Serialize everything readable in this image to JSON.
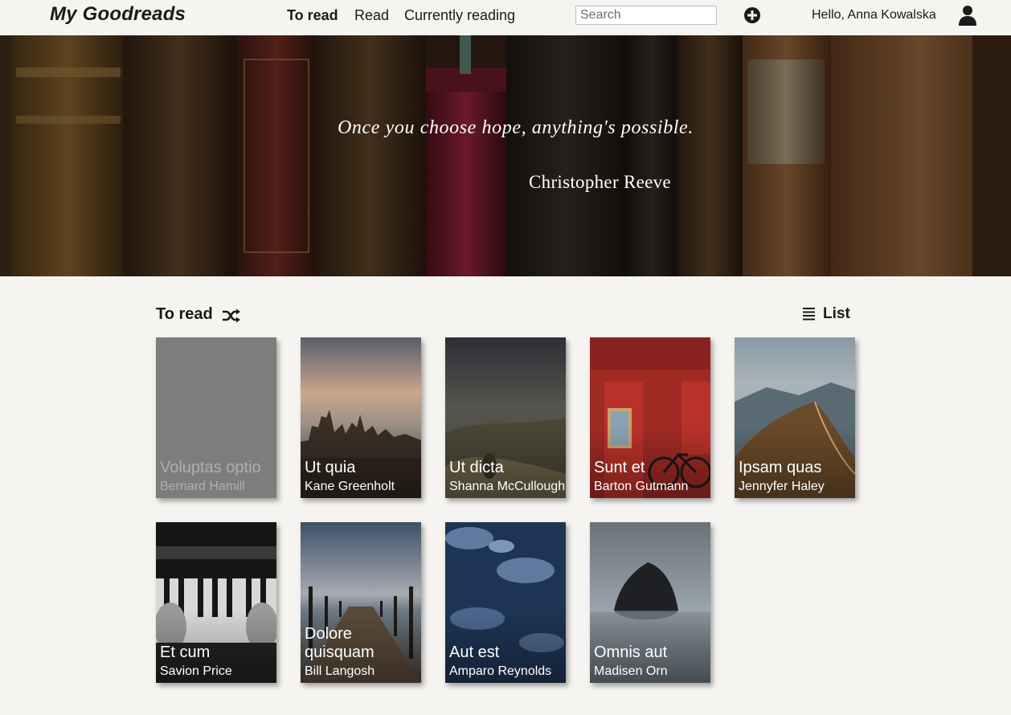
{
  "nav": {
    "brand": "My Goodreads",
    "links": [
      "To read",
      "Read",
      "Currently reading"
    ],
    "search_placeholder": "Search",
    "greeting": "Hello, Anna Kowalska"
  },
  "hero": {
    "quote": "Once you choose hope, anything's possible.",
    "author": "Christopher Reeve"
  },
  "section": {
    "title": "To read",
    "view_toggle": "List"
  },
  "books": [
    {
      "title": "Voluptas optio",
      "author": "Bernard Hamill"
    },
    {
      "title": "Ut quia",
      "author": "Kane Greenholt"
    },
    {
      "title": "Ut dicta",
      "author": "Shanna McCullough"
    },
    {
      "title": "Sunt et",
      "author": "Barton Gutmann"
    },
    {
      "title": "Ipsam quas",
      "author": "Jennyfer Haley"
    },
    {
      "title": "Et cum",
      "author": "Savion Price"
    },
    {
      "title": "Dolore quisquam",
      "author": "Bill Langosh"
    },
    {
      "title": "Aut est",
      "author": "Amparo Reynolds"
    },
    {
      "title": "Omnis aut",
      "author": "Madisen Orn"
    }
  ]
}
